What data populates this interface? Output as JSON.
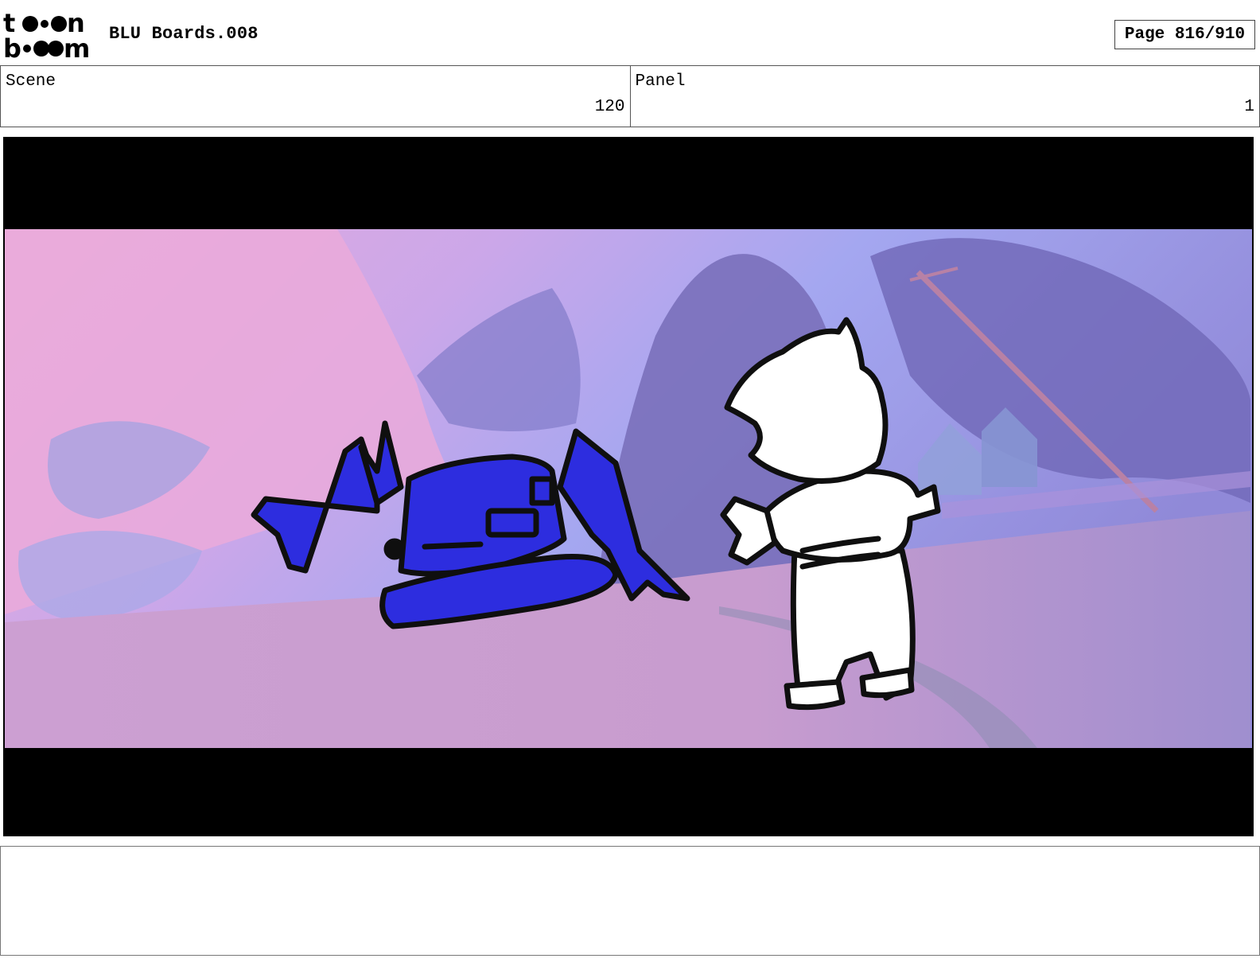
{
  "header": {
    "logo_top": "t••n",
    "logo_bottom": "b••m",
    "title": "BLU Boards.008",
    "page": "Page 816/910"
  },
  "info": {
    "scene_label": "Scene",
    "scene_value": "120",
    "panel_label": "Panel",
    "panel_value": "1"
  },
  "frame": {
    "letterbox_color": "#000000",
    "sky_color": "#9a9ff0",
    "ground_color": "#c596cc",
    "robot_color": "#2020dd"
  },
  "notes": {
    "text": ""
  }
}
